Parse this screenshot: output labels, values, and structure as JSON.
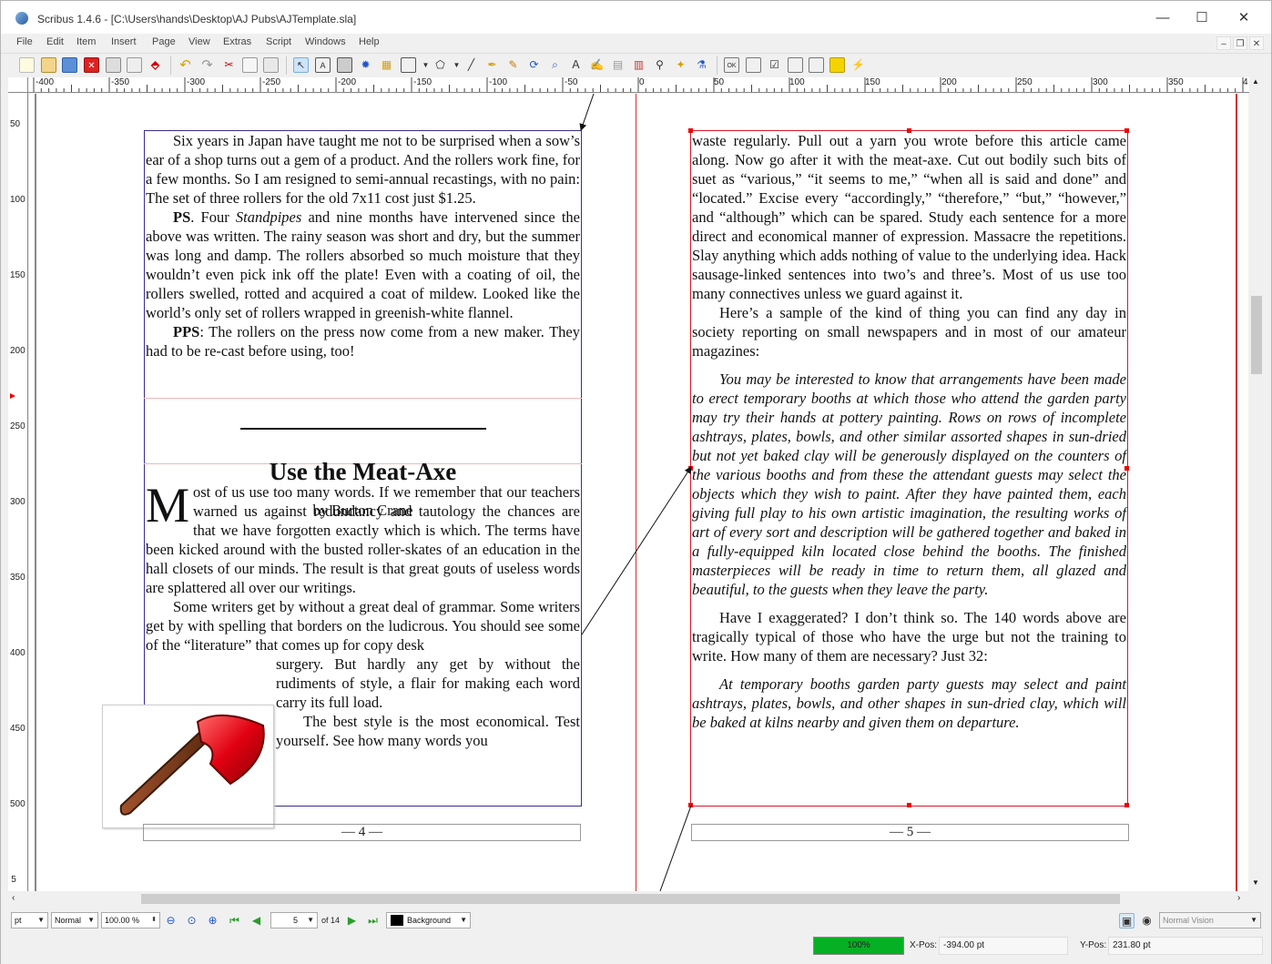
{
  "window": {
    "title": "Scribus 1.4.6 - [C:\\Users\\hands\\Desktop\\AJ Pubs\\AJTemplate.sla]",
    "minimize": "—",
    "maximize": "☐",
    "close": "✕"
  },
  "menu": [
    "File",
    "Edit",
    "Item",
    "Insert",
    "Page",
    "View",
    "Extras",
    "Script",
    "Windows",
    "Help"
  ],
  "mdi": {
    "min": "–",
    "restore": "❐",
    "close": "✕"
  },
  "ruler": {
    "h_labels": [
      "-400",
      "-350",
      "-300",
      "-250",
      "-200",
      "-150",
      "-100",
      "-50",
      "0",
      "50",
      "100",
      "150",
      "200",
      "250",
      "300",
      "350",
      "4"
    ],
    "v_labels": [
      "50",
      "100",
      "150",
      "200",
      "250",
      "300",
      "350",
      "400",
      "450",
      "500",
      "5"
    ]
  },
  "left_page": {
    "p1": "Six years in Japan have taught me not to be surprised when a sow’s ear of a shop turns out a gem of a product. And the rollers work fine, for a few months. So I am resigned to semi-annual recastings, with no pain: The set of three rollers for the old 7x11 cost just $1.25.",
    "ps_label": "PS",
    "ps_a": ". Four ",
    "ps_italic": "Standpipes",
    "ps_b": " and nine months have intervened since the above was written. The rainy season was short and dry, but the summer was long and damp. The rollers absorbed so much moisture that they wouldn’t even pick ink off the plate! Even with a coating of oil, the rollers swelled, rotted and acquired a coat of mildew. Looked like the world’s only set of rollers wrapped in greenish-white flannel.",
    "pps_label": "PPS",
    "pps_text": ": The rollers on the press now come from a new maker. They had to be re-cast before using, too!",
    "headline": "Use the Meat-Axe",
    "byline": "by Burton Crane",
    "dropcap": "M",
    "body1": "ost of us use too many words. If we remember that our teachers warned us against redundancy and tautology the chances are that we have forgotten exactly which is which. The terms have been kicked around with the busted roller-skates of an education in the hall closets of our minds. The result is that great gouts of useless words are splattered all over our writings.",
    "body2": "Some writers get by without a great deal of grammar. Some writers get by with spelling that borders on the ludicrous. You should see some of the “literature” that comes up for copy desk",
    "wrap1": "surgery. But hardly any get by without the rudiments of style, a flair for making each word carry its full load.",
    "wrap2": "The best style is the most economical. Test yourself. See how many words you",
    "page_number": "— 4 —"
  },
  "right_page": {
    "p1": "waste regularly. Pull out a yarn you wrote before this article came along. Now go after it with the meat-axe. Cut out bodily such bits of suet as “various,” “it seems to me,” “when all is said and done” and “located.” Excise every “accordingly,” “therefore,” “but,” “however,” and “although” which can be spared. Study each sentence for a more direct and economical manner of expression. Massacre the repetitions. Slay anything which adds nothing of value to the underlying idea. Hack sausage-linked sentences into two’s and three’s. Most of us use too many connectives unless we guard against it.",
    "p2": "Here’s a sample of the kind of thing you can find any day in society reporting on small newspapers and in most of our amateur magazines:",
    "quote1": "You may be interested to know that arrangements have been made to erect temporary booths at which those who attend the garden party may try their hands at pottery painting. Rows on rows of incomplete ashtrays, plates, bowls, and other similar assorted shapes in sun-dried but not yet baked clay will be generously displayed on the counters of the various booths and from these the attendant guests may select the objects which they wish to paint. After they have painted them, each giving full play to his own artistic imagination, the resulting works of art of every sort and description will be gathered together and baked in a fully-equipped kiln located close behind the booths. The finished masterpieces will be ready in time to return them, all glazed and beautiful, to the guests when they leave the party.",
    "p3": "Have I exaggerated? I don’t think so. The 140 words above are tragically typical of those who have the urge but not the training to write. How many of them are necessary? Just 32:",
    "quote2": "At temporary booths garden party guests may select and paint ashtrays, plates, bowls, and other shapes in sun-dried clay, which will be baked at kilns nearby and given them on departure.",
    "page_number": "— 5 —"
  },
  "bottom": {
    "unit": "pt",
    "mode": "Normal",
    "zoom": "100.00 %",
    "page": "5",
    "of": "of 14",
    "layer": "Background",
    "vision": "Normal Vision"
  },
  "status": {
    "progress": "100%",
    "xlabel": "X-Pos:",
    "xval": "-394.00 pt",
    "ylabel": "Y-Pos:",
    "yval": "231.80 pt"
  },
  "colors": {
    "frame_left": "#3a2d8c",
    "frame_right": "#d21a2a",
    "progress": "#06b025",
    "margin": "#cc3333"
  }
}
